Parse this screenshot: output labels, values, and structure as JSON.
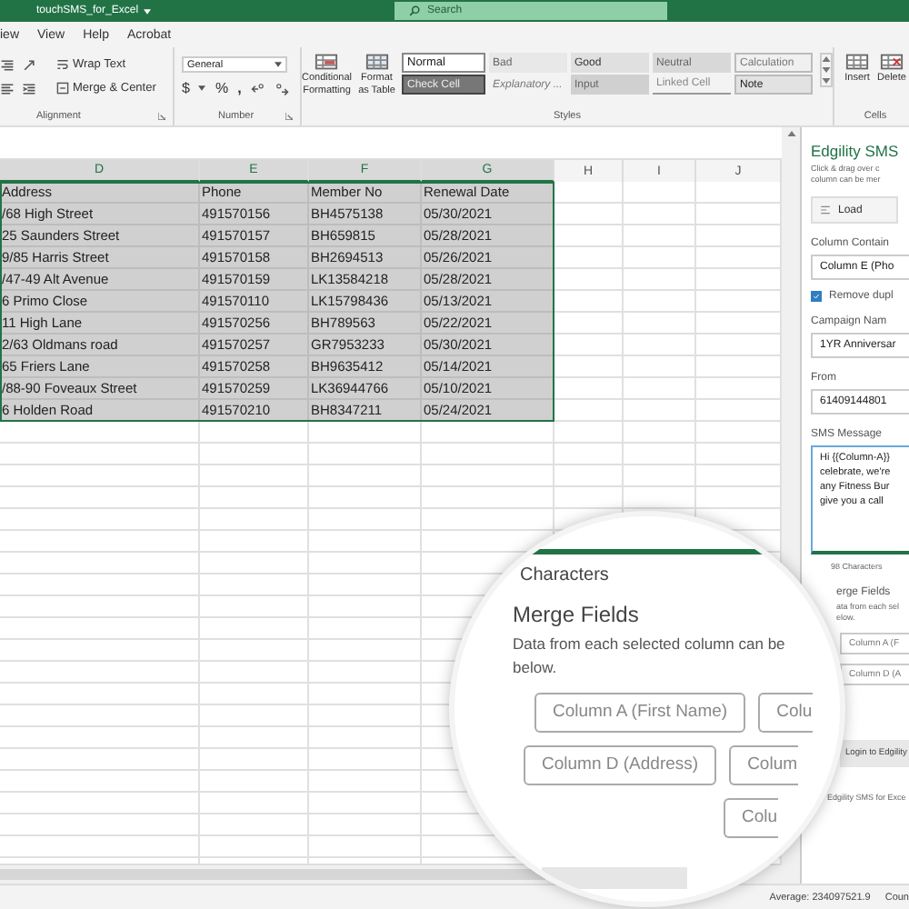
{
  "title_bar": {
    "file_name": "touchSMS_for_Excel",
    "search_placeholder": "Search"
  },
  "menu": [
    {
      "label": "iew"
    },
    {
      "label": "View"
    },
    {
      "label": "Help"
    },
    {
      "label": "Acrobat"
    }
  ],
  "ribbon": {
    "alignment": {
      "wrap_text": "Wrap Text",
      "merge": "Merge & Center",
      "label": "Alignment"
    },
    "number": {
      "format": "General",
      "currency": "$",
      "percent": "%",
      "comma": ",",
      "label": "Number"
    },
    "styles": {
      "conditional": "Conditional Formatting",
      "format_table": "Format as Table",
      "label": "Styles",
      "cells": [
        {
          "label": "Normal",
          "kind": "normal"
        },
        {
          "label": "Bad",
          "kind": "bad"
        },
        {
          "label": "Good",
          "kind": "good"
        },
        {
          "label": "Neutral",
          "kind": "neutral"
        },
        {
          "label": "Calculation",
          "kind": "calculation"
        },
        {
          "label": "Check Cell",
          "kind": "check"
        },
        {
          "label": "Explanatory ...",
          "kind": "explanatory"
        },
        {
          "label": "Input",
          "kind": "input"
        },
        {
          "label": "Linked Cell",
          "kind": "linked"
        },
        {
          "label": "Note",
          "kind": "note"
        }
      ]
    },
    "cells": {
      "insert": "Insert",
      "delete": "Delete",
      "label": "Cells"
    }
  },
  "sheet": {
    "columns": [
      {
        "letter": "D",
        "selected": true
      },
      {
        "letter": "E",
        "selected": true
      },
      {
        "letter": "F",
        "selected": true
      },
      {
        "letter": "G",
        "selected": true
      },
      {
        "letter": "H",
        "selected": false
      },
      {
        "letter": "I",
        "selected": false
      },
      {
        "letter": "J",
        "selected": false
      }
    ],
    "rows": [
      {
        "selected": true,
        "cells": [
          "Address",
          "Phone",
          "Member No",
          "Renewal Date"
        ]
      },
      {
        "selected": true,
        "cells": [
          "/68 High Street",
          "491570156",
          "BH4575138",
          "05/30/2021"
        ]
      },
      {
        "selected": true,
        "cells": [
          "25 Saunders Street",
          "491570157",
          "BH659815",
          "05/28/2021"
        ]
      },
      {
        "selected": true,
        "cells": [
          "9/85 Harris Street",
          "491570158",
          "BH2694513",
          "05/26/2021"
        ]
      },
      {
        "selected": true,
        "cells": [
          "/47-49 Alt Avenue",
          "491570159",
          "LK13584218",
          "05/28/2021"
        ]
      },
      {
        "selected": true,
        "cells": [
          "6 Primo Close",
          "491570110",
          "LK15798436",
          "05/13/2021"
        ]
      },
      {
        "selected": true,
        "cells": [
          "11 High Lane",
          "491570256",
          "BH789563",
          "05/22/2021"
        ]
      },
      {
        "selected": true,
        "cells": [
          "2/63 Oldmans road",
          "491570257",
          "GR7953233",
          "05/30/2021"
        ]
      },
      {
        "selected": true,
        "cells": [
          "65 Friers Lane",
          "491570258",
          "BH9635412",
          "05/14/2021"
        ]
      },
      {
        "selected": true,
        "cells": [
          "/88-90 Foveaux Street",
          "491570259",
          "LK36944766",
          "05/10/2021"
        ]
      },
      {
        "selected": true,
        "cells": [
          "6 Holden Road",
          "491570210",
          "BH8347211",
          "05/24/2021"
        ]
      }
    ]
  },
  "task_pane": {
    "title": "Edgility SMS",
    "intro": [
      "Click & drag over c",
      "column can be mer"
    ],
    "load_button": "Load",
    "column_label": "Column Contain",
    "column_value": "Column E (Pho",
    "remove_duplicates": {
      "label": "Remove dupl",
      "checked": true
    },
    "campaign_label": "Campaign Nam",
    "campaign_value": "1YR Anniversar",
    "from_label": "From",
    "from_value": "61409144801",
    "message_label": "SMS Message",
    "message_lines": [
      "Hi {{Column-A}}",
      "celebrate, we're",
      "any Fitness Bur",
      "give you a call"
    ],
    "characters": "98 Characters",
    "merge_title": "erge Fields",
    "merge_text": [
      "ata from each sel",
      "elow."
    ],
    "merge_buttons": [
      "Column A (F",
      "Column D (A"
    ],
    "login_button": "Login to Edgility",
    "footer": "Edgility SMS for Exce"
  },
  "magnifier": {
    "characters": "Characters",
    "merge_title": "Merge Fields",
    "merge_text": [
      "Data from each selected column can be",
      "below."
    ],
    "button_rows": [
      [
        "Column A (First Name)",
        "Colu"
      ],
      [
        "Column D (Address)",
        "Colum"
      ],
      [
        "Colu"
      ]
    ]
  },
  "status_bar": {
    "average": "Average: 234097521.9",
    "count": "Coun"
  }
}
